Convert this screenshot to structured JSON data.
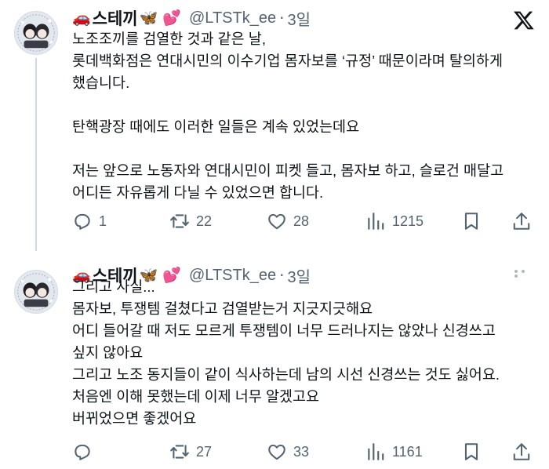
{
  "tweets": [
    {
      "author": {
        "emoji_prefix": "🚗",
        "name": "스테끼",
        "emoji_suffix": "🦋 💕",
        "handle": "@LTSTk_ee",
        "time": "3일"
      },
      "text": "노조조끼를 검열한 것과 같은 날,\n롯데백화점은 연대시민의 이수기업 몸자보를 ‘규정’ 때문이라며 탈의하게\n했습니다.\n\n탄핵광장 때에도 이러한 일들은 계속 있었는데요\n\n저는 앞으로 노동자와 연대시민이 피켓 들고, 몸자보 하고, 슬로건 매달고\n어디든 자유롭게 다닐 수 있었으면 합니다.",
      "stats": {
        "replies": "1",
        "retweets": "22",
        "likes": "28",
        "views": "1215"
      }
    },
    {
      "author": {
        "emoji_prefix": "🚗",
        "name": "스테끼",
        "emoji_suffix": "🦋 💕",
        "handle": "@LTSTk_ee",
        "time": "3일"
      },
      "text": "그리고 사실...\n몸자보, 투쟁템 걸쳤다고 검열받는거 지긋지긋해요\n어디 들어갈 때 저도 모르게 투쟁템이 너무 드러나지는 않았나 신경쓰고\n싶지 않아요\n그리고 노조 동지들이 같이 식사하는데 남의 시선 신경쓰는 것도 싫어요.\n처음엔 이해 못했는데 이제 너무 알겠고요\n버뀌었으면 좋겠어요",
      "stats": {
        "replies": "",
        "retweets": "27",
        "likes": "33",
        "views": "1161"
      }
    }
  ],
  "colors": {
    "text": "#0f1419",
    "muted": "#536471",
    "thread_line": "#cfd9de"
  },
  "icons": [
    "x-logo-icon",
    "reply-icon",
    "retweet-icon",
    "like-icon",
    "views-icon",
    "bookmark-icon",
    "share-icon",
    "more-icon"
  ]
}
